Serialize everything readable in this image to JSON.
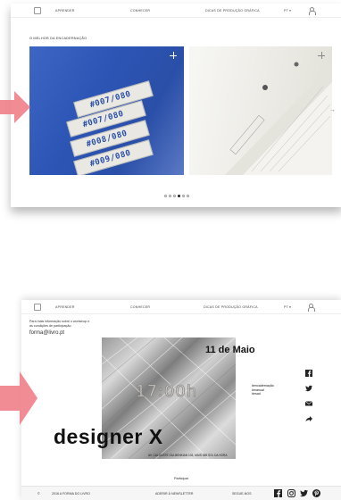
{
  "nav": {
    "aprender": "APRENDER",
    "conhecer": "CONHECER",
    "dicas": "DICAS DE PRODUÇÃO GRÁFICA",
    "lang": "PT ▾"
  },
  "slider": {
    "section_title": "O MELHOR DA ENCADERNAÇÃO",
    "tab_codes": [
      "#007/080",
      "#007/080",
      "#008/080",
      "#009/080"
    ],
    "dot_count": 6,
    "active_dot": 3
  },
  "event": {
    "info_text_line1": "Para mais informação sobre o workshop e",
    "info_text_line2": "as condições de participação:",
    "email": "forma@livro.pt",
    "date": "11 de Maio",
    "time": "17:00h",
    "tags": [
      "#encadernação",
      "#manual",
      "#esad"
    ],
    "title": "designer X",
    "address": "AV. CALOUSTE GULBENKIAN 103, MAIS 058 SOL DA HORA",
    "participate": "Participar"
  },
  "footer": {
    "copyright": "©",
    "brand": "2016 A FORMA DO LIVRO",
    "newsletter": "ADERIR À NEWSLETTER",
    "follow": "SEGUE-NOS"
  },
  "colors": {
    "accent_pink": "#f07f8a",
    "blue_folder": "#2f58b8"
  }
}
